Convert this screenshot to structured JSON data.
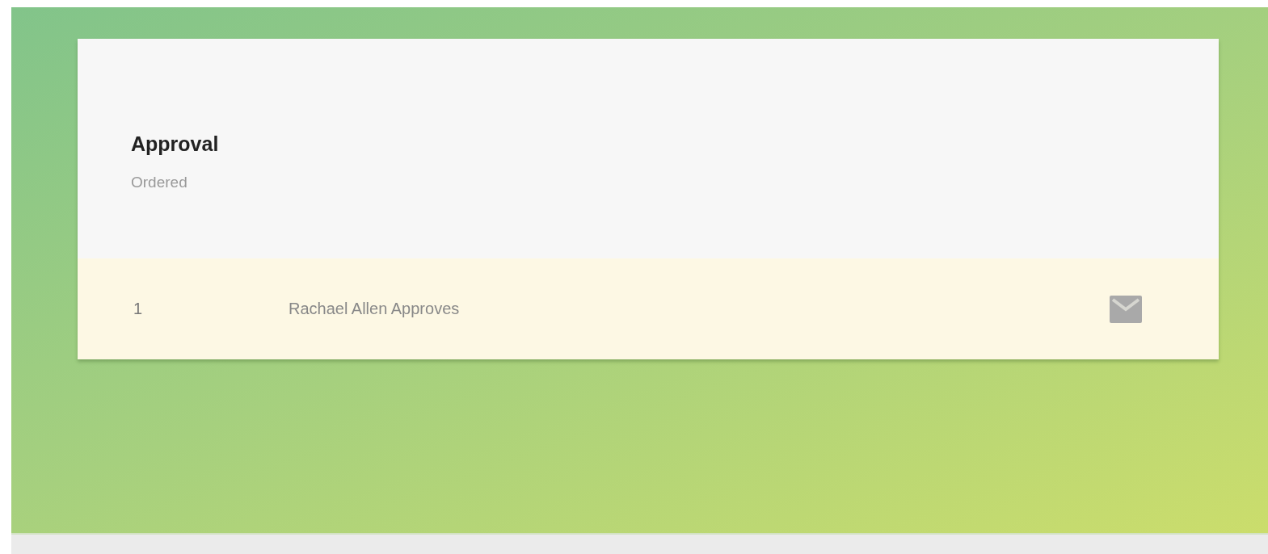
{
  "card": {
    "title": "Approval",
    "subtitle": "Ordered"
  },
  "steps": [
    {
      "number": "1",
      "name": "Rachael Allen Approves"
    }
  ]
}
